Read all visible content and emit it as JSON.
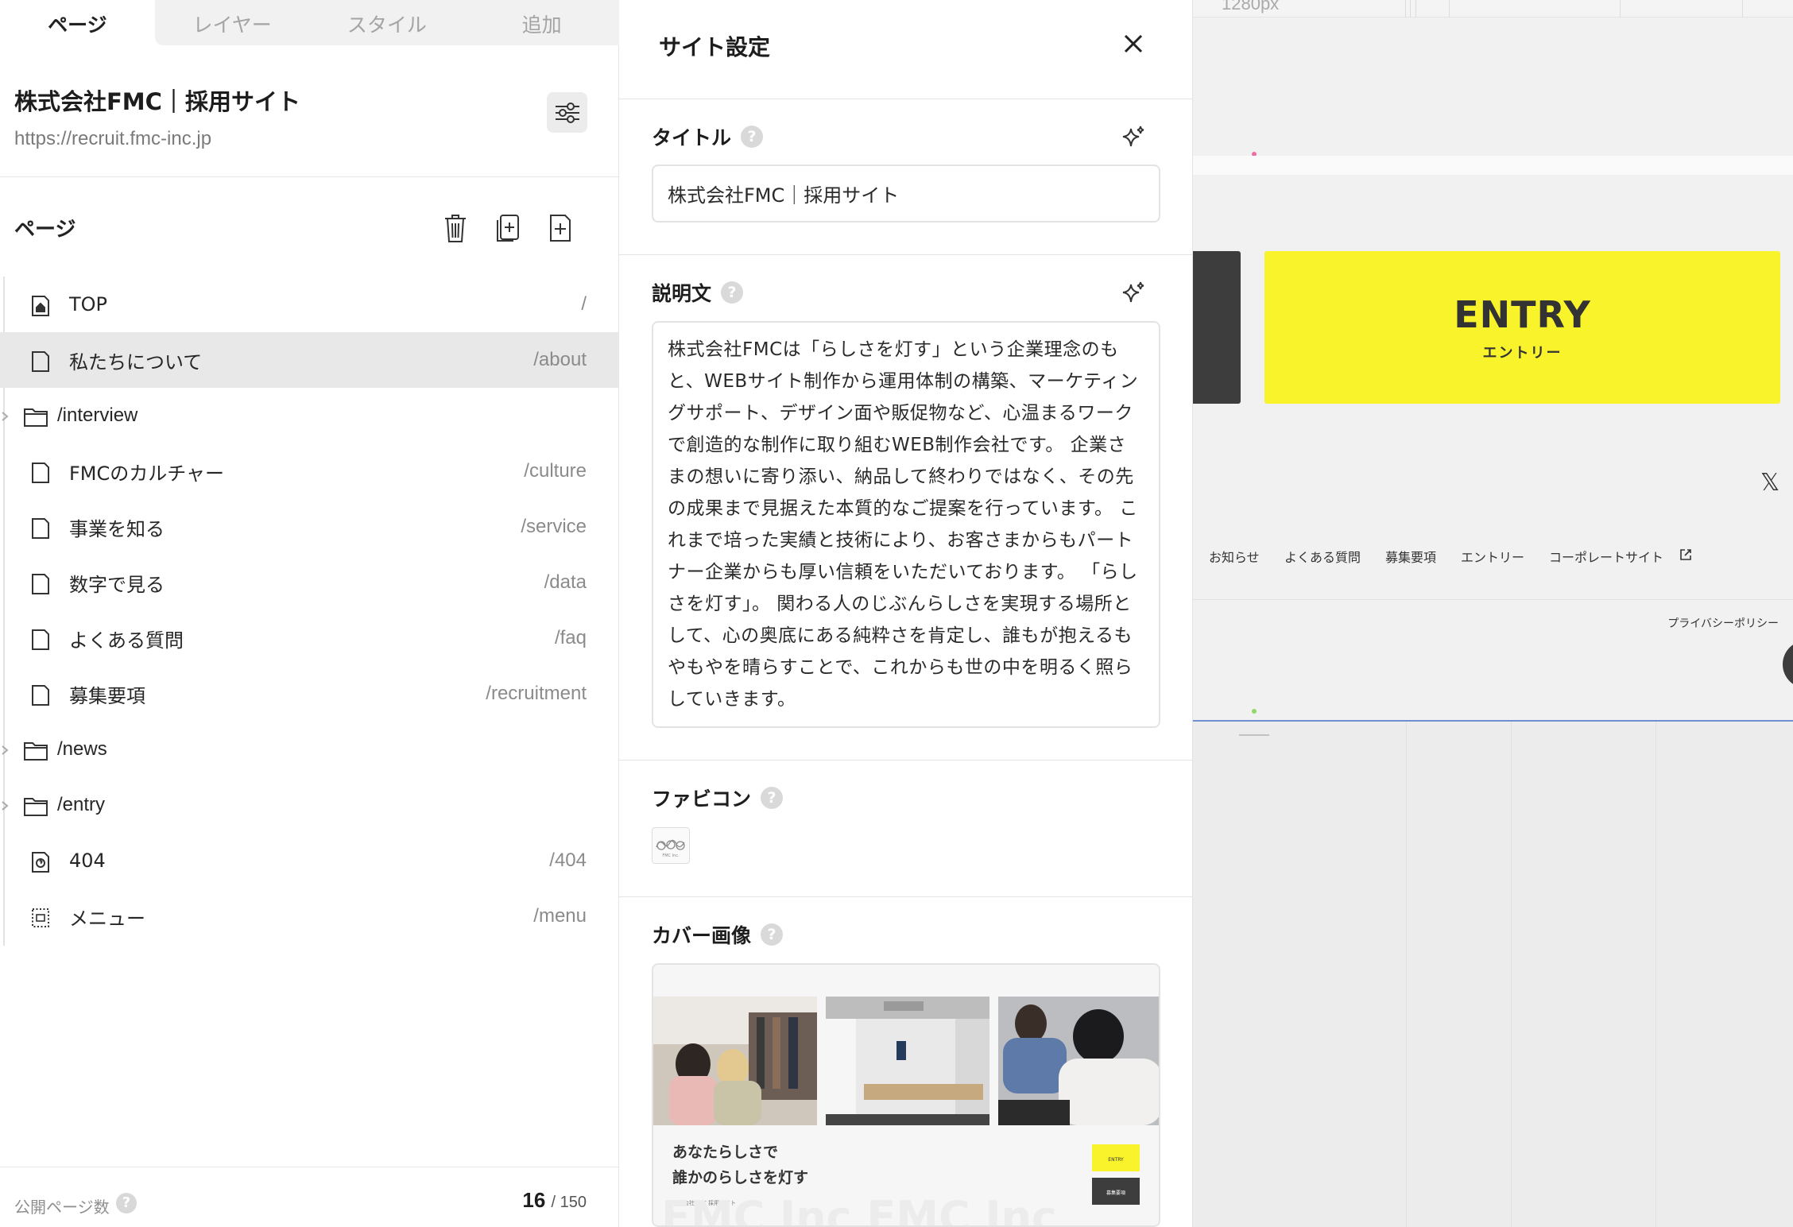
{
  "tabs": [
    {
      "label": "ページ",
      "active": true
    },
    {
      "label": "レイヤー",
      "active": false
    },
    {
      "label": "スタイル",
      "active": false
    },
    {
      "label": "追加",
      "active": false
    }
  ],
  "site": {
    "title": "株式会社FMC｜採用サイト",
    "url": "https://recruit.fmc-inc.jp"
  },
  "pages_section": {
    "label": "ページ",
    "items": [
      {
        "type": "home",
        "label": "TOP",
        "path": "/"
      },
      {
        "type": "page",
        "label": "私たちについて",
        "path": "/about",
        "selected": true
      },
      {
        "type": "folder",
        "label": "/interview"
      },
      {
        "type": "page",
        "label": "FMCのカルチャー",
        "path": "/culture"
      },
      {
        "type": "page",
        "label": "事業を知る",
        "path": "/service"
      },
      {
        "type": "page",
        "label": "数字で見る",
        "path": "/data"
      },
      {
        "type": "page",
        "label": "よくある質問",
        "path": "/faq"
      },
      {
        "type": "page",
        "label": "募集要項",
        "path": "/recruitment"
      },
      {
        "type": "folder",
        "label": "/news"
      },
      {
        "type": "folder",
        "label": "/entry"
      },
      {
        "type": "error",
        "label": "404",
        "path": "/404"
      },
      {
        "type": "menu",
        "label": "メニュー",
        "path": "/menu"
      }
    ]
  },
  "footer": {
    "label": "公開ページ数",
    "count": "16",
    "total": "/ 150"
  },
  "settings": {
    "title": "サイト設定",
    "title_field": {
      "label": "タイトル",
      "value": "株式会社FMC｜採用サイト"
    },
    "description_field": {
      "label": "説明文",
      "value": "株式会社FMCは「らしさを灯す」という企業理念のもと、WEBサイト制作から運用体制の構築、マーケティングサポート、デザイン面や販促物など、心温まるワークで創造的な制作に取り組むWEB制作会社です。 企業さまの想いに寄り添い、納品して終わりではなく、その先の成果まで見据えた本質的なご提案を行っています。 これまで培った実績と技術により、お客さまからもパートナー企業からも厚い信頼をいただいております。 「らしさを灯す」。 関わる人のじぶんらしさを実現する場所として、心の奥底にある純粋さを肯定し、誰もが抱えるもやもやを晴らすことで、これからも世の中を明るく照らしていきます。"
    },
    "favicon": {
      "label": "ファビコン",
      "image_text": "FMC Inc."
    },
    "cover": {
      "label": "カバー画像",
      "headline_1": "あなたらしさで",
      "headline_2": "誰かのらしさを灯す",
      "entry_small": "ENTRY",
      "recruit_small": "募集要項",
      "caption": "株式会社FMC 採用サイト",
      "bg_text": "FMC Inc FMC Inc"
    }
  },
  "canvas": {
    "ruler_label": "1280px",
    "entry_main": "ENTRY",
    "entry_sub": "エントリー",
    "x_icon": "𝕏",
    "nav": [
      "お知らせ",
      "よくある質問",
      "募集要項",
      "エントリー",
      "コーポレートサイト"
    ],
    "privacy": "プライバシーポリシー"
  },
  "colors": {
    "accent_yellow": "#f8f32b",
    "dark": "#3d3d3d",
    "selected_row": "#e8e8e8"
  }
}
